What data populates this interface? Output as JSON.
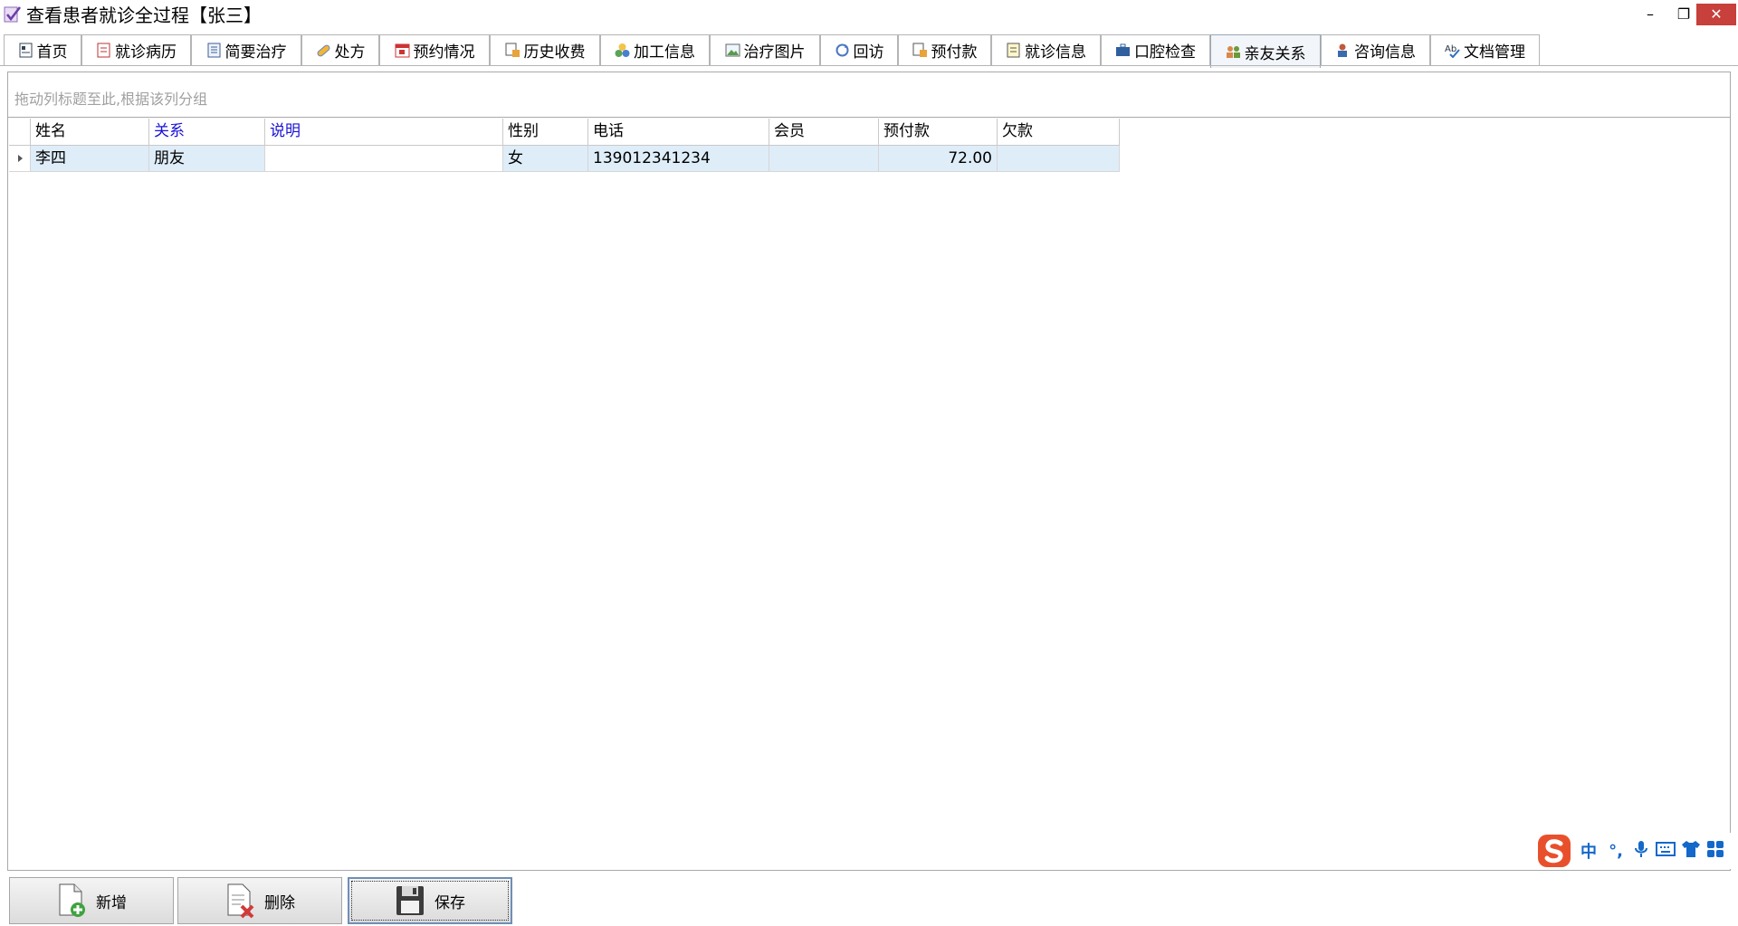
{
  "window": {
    "title": "查看患者就诊全过程【张三】"
  },
  "tabs": [
    {
      "label": "首页",
      "icon": "home-doc-icon"
    },
    {
      "label": "就诊病历",
      "icon": "medical-record-icon"
    },
    {
      "label": "简要治疗",
      "icon": "notes-icon"
    },
    {
      "label": "处方",
      "icon": "pill-icon"
    },
    {
      "label": "预约情况",
      "icon": "calendar-icon"
    },
    {
      "label": "历史收费",
      "icon": "billing-icon"
    },
    {
      "label": "加工信息",
      "icon": "processing-icon"
    },
    {
      "label": "治疗图片",
      "icon": "picture-icon"
    },
    {
      "label": "回访",
      "icon": "refresh-icon"
    },
    {
      "label": "预付款",
      "icon": "prepay-icon"
    },
    {
      "label": "就诊信息",
      "icon": "info-icon"
    },
    {
      "label": "口腔检查",
      "icon": "briefcase-icon"
    },
    {
      "label": "亲友关系",
      "icon": "people-icon",
      "active": true
    },
    {
      "label": "咨询信息",
      "icon": "consult-icon"
    },
    {
      "label": "文档管理",
      "icon": "spellcheck-icon"
    }
  ],
  "grid": {
    "group_hint": "拖动列标题至此,根据该列分组",
    "columns": [
      "姓名",
      "关系",
      "说明",
      "性别",
      "电话",
      "会员",
      "预付款",
      "欠款"
    ],
    "rows": [
      [
        "李四",
        "朋友",
        "",
        "女",
        "139012341234",
        "",
        "72.00",
        ""
      ]
    ]
  },
  "buttons": {
    "add": "新增",
    "delete": "删除",
    "save": "保存"
  },
  "ime": {
    "lang": "中",
    "punct": "°,",
    "colors": {
      "logo": "#e8502c",
      "glyph": "#1468c9"
    }
  },
  "colors": {
    "selected_row": "#deedf8",
    "header_blue": "#1a12d6",
    "close_button": "#c7403b"
  }
}
